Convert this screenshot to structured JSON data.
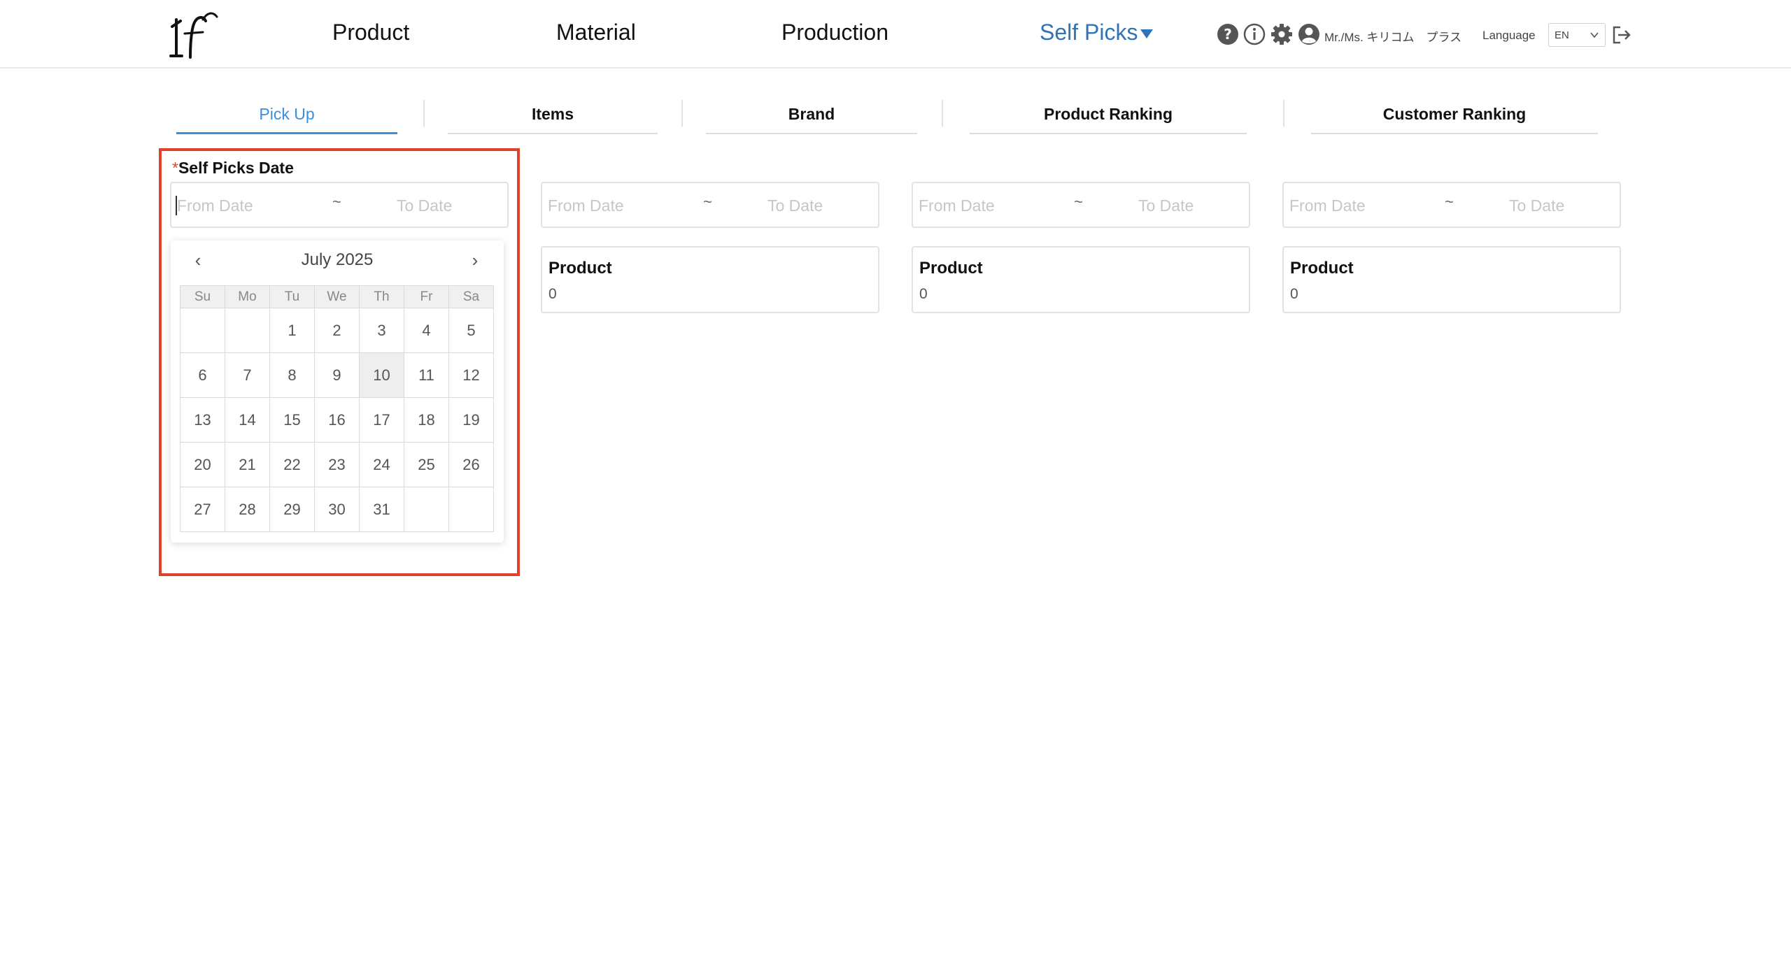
{
  "header": {
    "nav": [
      "Product",
      "Material",
      "Production",
      "Self Picks"
    ],
    "active_nav": "Self Picks",
    "icons": [
      "question-circle-icon",
      "info-circle-icon",
      "gear-icon",
      "user-circle-icon",
      "logout-icon"
    ],
    "user_name": "Mr./Ms. キリコム　プラス",
    "language_label": "Language",
    "language_value": "EN"
  },
  "tabs": [
    "Pick Up",
    "Items",
    "Brand",
    "Product Ranking",
    "Customer Ranking"
  ],
  "active_tab": "Pick Up",
  "filter": {
    "required_mark": "*",
    "label": "Self Picks Date",
    "from_placeholder": "From Date",
    "separator": "~",
    "to_placeholder": "To Date"
  },
  "cards": [
    {
      "title": "Product",
      "value": "0"
    },
    {
      "title": "Product",
      "value": "0"
    },
    {
      "title": "Product",
      "value": "0"
    }
  ],
  "calendar": {
    "prev": "‹",
    "next": "›",
    "title": "July 2025",
    "weekdays": [
      "Su",
      "Mo",
      "Tu",
      "We",
      "Th",
      "Fr",
      "Sa"
    ],
    "weeks": [
      [
        "",
        "",
        "1",
        "2",
        "3",
        "4",
        "5"
      ],
      [
        "6",
        "7",
        "8",
        "9",
        "10",
        "11",
        "12"
      ],
      [
        "13",
        "14",
        "15",
        "16",
        "17",
        "18",
        "19"
      ],
      [
        "20",
        "21",
        "22",
        "23",
        "24",
        "25",
        "26"
      ],
      [
        "27",
        "28",
        "29",
        "30",
        "31",
        "",
        ""
      ]
    ],
    "highlighted_day": "10"
  },
  "colors": {
    "accent": "#2f73b8",
    "tab_active": "#3a8ee0",
    "highlight_border": "#e0412e"
  }
}
